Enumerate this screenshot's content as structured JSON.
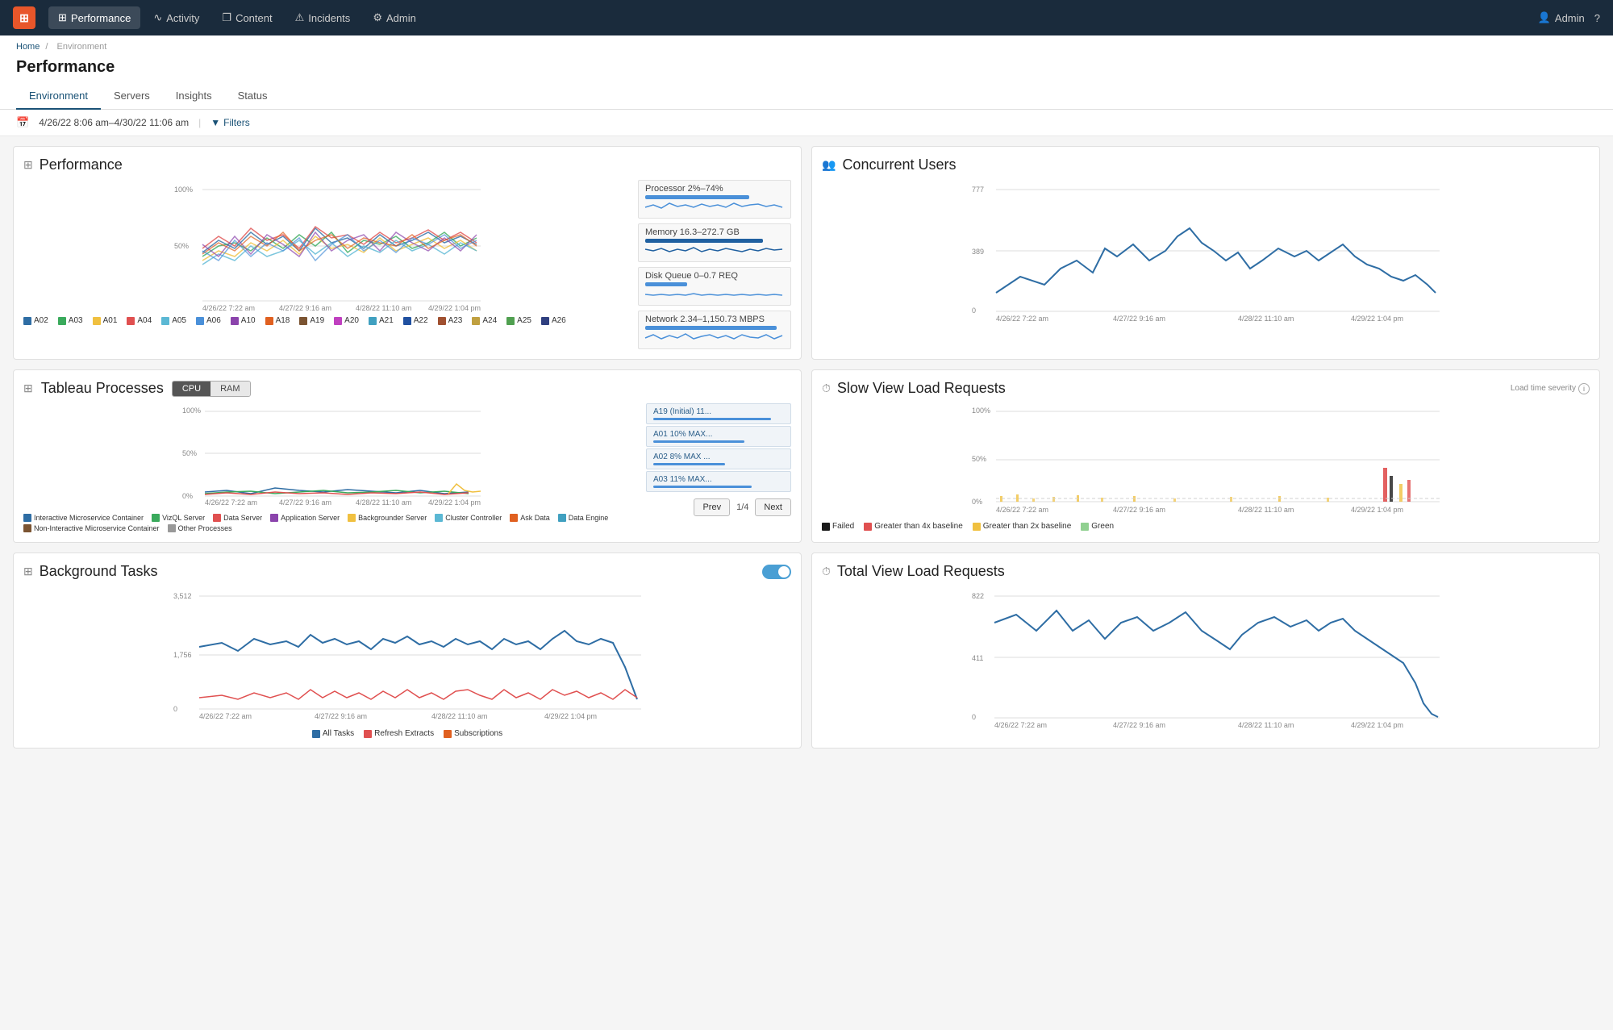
{
  "topNav": {
    "logo": "⊞",
    "items": [
      {
        "label": "Performance",
        "icon": "⊞",
        "active": true
      },
      {
        "label": "Activity",
        "icon": "∿"
      },
      {
        "label": "Content",
        "icon": "❐"
      },
      {
        "label": "Incidents",
        "icon": "⚠"
      },
      {
        "label": "Admin",
        "icon": "⚙"
      }
    ],
    "adminLabel": "Admin",
    "helpIcon": "?"
  },
  "breadcrumb": {
    "home": "Home",
    "separator": "/",
    "current": "Environment"
  },
  "pageTitle": "Performance",
  "tabs": [
    {
      "label": "Environment",
      "active": true
    },
    {
      "label": "Servers"
    },
    {
      "label": "Insights"
    },
    {
      "label": "Status"
    }
  ],
  "filterBar": {
    "dateRange": "4/26/22 8:06 am–4/30/22 11:06 am",
    "separator": "|",
    "filtersLabel": "Filters"
  },
  "performanceChart": {
    "title": "Performance",
    "yLabels": [
      "100%",
      "50%"
    ],
    "xLabels": [
      "4/26/22 7:22 am",
      "4/27/22 9:16 am",
      "4/28/22 11:10 am",
      "4/29/22 1:04 pm"
    ],
    "legend": [
      {
        "label": "A02",
        "color": "#2e6da4"
      },
      {
        "label": "A03",
        "color": "#3aaa5c"
      },
      {
        "label": "A01",
        "color": "#f0c040"
      },
      {
        "label": "A04",
        "color": "#e05050"
      },
      {
        "label": "A05",
        "color": "#5bb8d4"
      },
      {
        "label": "A06",
        "color": "#4a90d9"
      },
      {
        "label": "A10",
        "color": "#8b44ac"
      },
      {
        "label": "A18",
        "color": "#e06020"
      },
      {
        "label": "A19",
        "color": "#7b5432"
      },
      {
        "label": "A20",
        "color": "#c040c0"
      },
      {
        "label": "A21",
        "color": "#40a0c0"
      },
      {
        "label": "A22",
        "color": "#2050a0"
      },
      {
        "label": "A23",
        "color": "#a05030"
      },
      {
        "label": "A24",
        "color": "#c0a040"
      },
      {
        "label": "A25",
        "color": "#50a050"
      },
      {
        "label": "A26",
        "color": "#304080"
      }
    ],
    "metrics": [
      {
        "label": "Processor 2%–74%",
        "barWidth": "75%",
        "color": "#4a90d9"
      },
      {
        "label": "Memory 16.3–272.7 GB",
        "barWidth": "85%",
        "color": "#2060a0"
      },
      {
        "label": "Disk Queue 0–0.7 REQ",
        "barWidth": "30%",
        "color": "#4a90d9"
      },
      {
        "label": "Network 2.34–1,150.73 MBPS",
        "barWidth": "95%",
        "color": "#4a90d9"
      }
    ]
  },
  "tableauProcesses": {
    "title": "Tableau Processes",
    "cpuBtn": "CPU",
    "ramBtn": "RAM",
    "activeModeBtn": "CPU",
    "yLabels": [
      "100%",
      "50%",
      "0%"
    ],
    "xLabels": [
      "4/26/22 7:22 am",
      "4/27/22 9:16 am",
      "4/28/22 11:10 am",
      "4/29/22 1:04 pm"
    ],
    "processItems": [
      {
        "label": "A19 (Initial) 11...",
        "barWidth": "90%"
      },
      {
        "label": "A01 10% MAX...",
        "barWidth": "70%"
      },
      {
        "label": "A02 8% MAX ...",
        "barWidth": "55%"
      },
      {
        "label": "A03 11% MAX...",
        "barWidth": "75%"
      }
    ],
    "pagination": {
      "prev": "Prev",
      "info": "1/4",
      "next": "Next"
    },
    "legend": [
      {
        "label": "Interactive Microservice Container",
        "color": "#2e6da4"
      },
      {
        "label": "VizQL Server",
        "color": "#3aaa5c"
      },
      {
        "label": "Data Server",
        "color": "#e05050"
      },
      {
        "label": "Application Server",
        "color": "#8b44ac"
      },
      {
        "label": "Backgrounder Server",
        "color": "#f0c040"
      },
      {
        "label": "Cluster Controller",
        "color": "#5bb8d4"
      },
      {
        "label": "Ask Data",
        "color": "#e06020"
      },
      {
        "label": "Data Engine",
        "color": "#40a0c0"
      },
      {
        "label": "Non-Interactive Microservice Container",
        "color": "#7b5432"
      },
      {
        "label": "Other Processes",
        "color": "#999"
      }
    ]
  },
  "backgroundTasks": {
    "title": "Background Tasks",
    "toggleOn": true,
    "yLabels": [
      "3,512",
      "1,756",
      "0"
    ],
    "xLabels": [
      "4/26/22 7:22 am",
      "4/27/22 9:16 am",
      "4/28/22 11:10 am",
      "4/29/22 1:04 pm"
    ],
    "legend": [
      {
        "label": "All Tasks",
        "color": "#2e6da4"
      },
      {
        "label": "Refresh Extracts",
        "color": "#e05050"
      },
      {
        "label": "Subscriptions",
        "color": "#e06020"
      }
    ]
  },
  "concurrentUsers": {
    "title": "Concurrent Users",
    "yLabels": [
      "777",
      "389",
      "0"
    ],
    "xLabels": [
      "4/26/22 7:22 am",
      "4/27/22 9:16 am",
      "4/28/22 11:10 am",
      "4/29/22 1:04 pm"
    ]
  },
  "slowViewLoad": {
    "title": "Slow View Load Requests",
    "severityLabel": "Load time severity",
    "yLabels": [
      "100%",
      "50%",
      "0%"
    ],
    "xLabels": [
      "4/26/22 7:22 am",
      "4/27/22 9:16 am",
      "4/28/22 11:10 am",
      "4/29/22 1:04 pm"
    ],
    "legend": [
      {
        "label": "Failed",
        "color": "#1a1a1a"
      },
      {
        "label": "Greater than 4x baseline",
        "color": "#e05050"
      },
      {
        "label": "Greater than 2x baseline",
        "color": "#f0c040"
      },
      {
        "label": "Green",
        "color": "#90d090"
      }
    ]
  },
  "totalViewLoad": {
    "title": "Total View Load Requests",
    "yLabels": [
      "822",
      "411",
      "0"
    ],
    "xLabels": [
      "4/26/22 7:22 am",
      "4/27/22 9:16 am",
      "4/28/22 11:10 am",
      "4/29/22 1:04 pm"
    ]
  }
}
